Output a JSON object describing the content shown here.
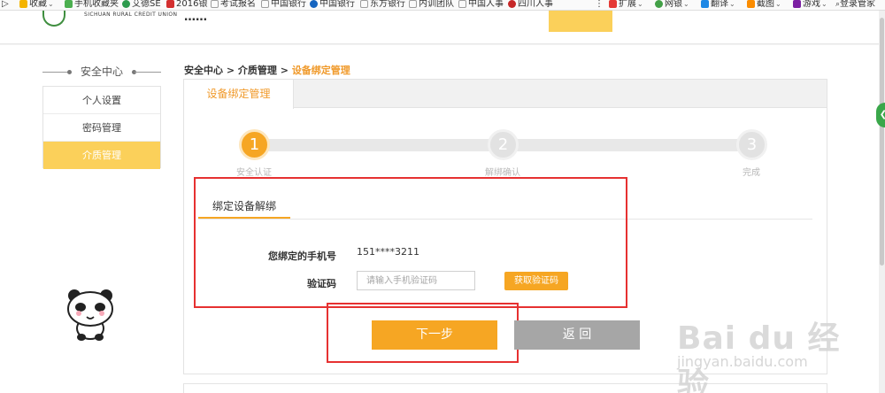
{
  "bookmarks": [
    {
      "label": "收藏",
      "icon": "star-icon",
      "color": "#f4b400",
      "caret": true
    },
    {
      "label": "手机收藏夹",
      "icon": "phone-icon",
      "color": "#4caf50"
    },
    {
      "label": "艾德SE",
      "icon": "globe-icon",
      "color": "#2e9b4e"
    },
    {
      "label": "2016银",
      "icon": "bank-icon",
      "color": "#d32f2f"
    },
    {
      "label": "考试报名",
      "icon": "page-icon",
      "color": "#9e9e9e"
    },
    {
      "label": "中国银行",
      "icon": "page-icon",
      "color": "#9e9e9e"
    },
    {
      "label": "中国银行",
      "icon": "bank-icon",
      "color": "#1565c0"
    },
    {
      "label": "东方银行",
      "icon": "page-icon",
      "color": "#9e9e9e"
    },
    {
      "label": "内训团队",
      "icon": "page-icon",
      "color": "#9e9e9e"
    },
    {
      "label": "中国人事",
      "icon": "page-icon",
      "color": "#9e9e9e"
    },
    {
      "label": "四川人事",
      "icon": "badge-icon",
      "color": "#c62828"
    }
  ],
  "toolbar_right": [
    {
      "label": "扩展",
      "icon": "grid-icon",
      "color": "#e53935"
    },
    {
      "label": "网银",
      "icon": "shield-icon",
      "color": "#43a047"
    },
    {
      "label": "翻译",
      "icon": "translate-icon",
      "color": "#1e88e5"
    },
    {
      "label": "截图",
      "icon": "scissors-icon",
      "color": "#fb8c00"
    },
    {
      "label": "游戏",
      "icon": "gamepad-icon",
      "color": "#7b1fa2"
    },
    {
      "label": "登录管家",
      "icon": "search-icon",
      "color": "#757575"
    }
  ],
  "header": {
    "logo_text": "SICHUAN RURAL CREDIT UNION",
    "partial_title": "……"
  },
  "nav": {
    "title": "安全中心",
    "items": [
      {
        "label": "个人设置",
        "active": false
      },
      {
        "label": "密码管理",
        "active": false
      },
      {
        "label": "介质管理",
        "active": true
      }
    ]
  },
  "breadcrumb": {
    "items": [
      "安全中心",
      "介质管理"
    ],
    "separator": ">",
    "current": "设备绑定管理"
  },
  "panel": {
    "tab": "设备绑定管理"
  },
  "steps": [
    {
      "number": "1",
      "label": "安全认证",
      "state": "active"
    },
    {
      "number": "2",
      "label": "解绑确认",
      "state": "pending"
    },
    {
      "number": "3",
      "label": "完成",
      "state": "pending"
    }
  ],
  "bind": {
    "tab": "绑定设备解绑",
    "phone_label": "您绑定的手机号",
    "phone_value": "151****3211",
    "code_label": "验证码",
    "code_placeholder": "请输入手机验证码",
    "get_code_label": "获取验证码"
  },
  "buttons": {
    "next": "下一步",
    "back": "返 回"
  },
  "watermark": {
    "main": "Bai du 经验",
    "sub": "jingyan.baidu.com"
  },
  "colors": {
    "accent": "#f6a623",
    "nav_active": "#fbd05a",
    "annotation": "#e63131",
    "back_button": "#a6a6a6"
  }
}
